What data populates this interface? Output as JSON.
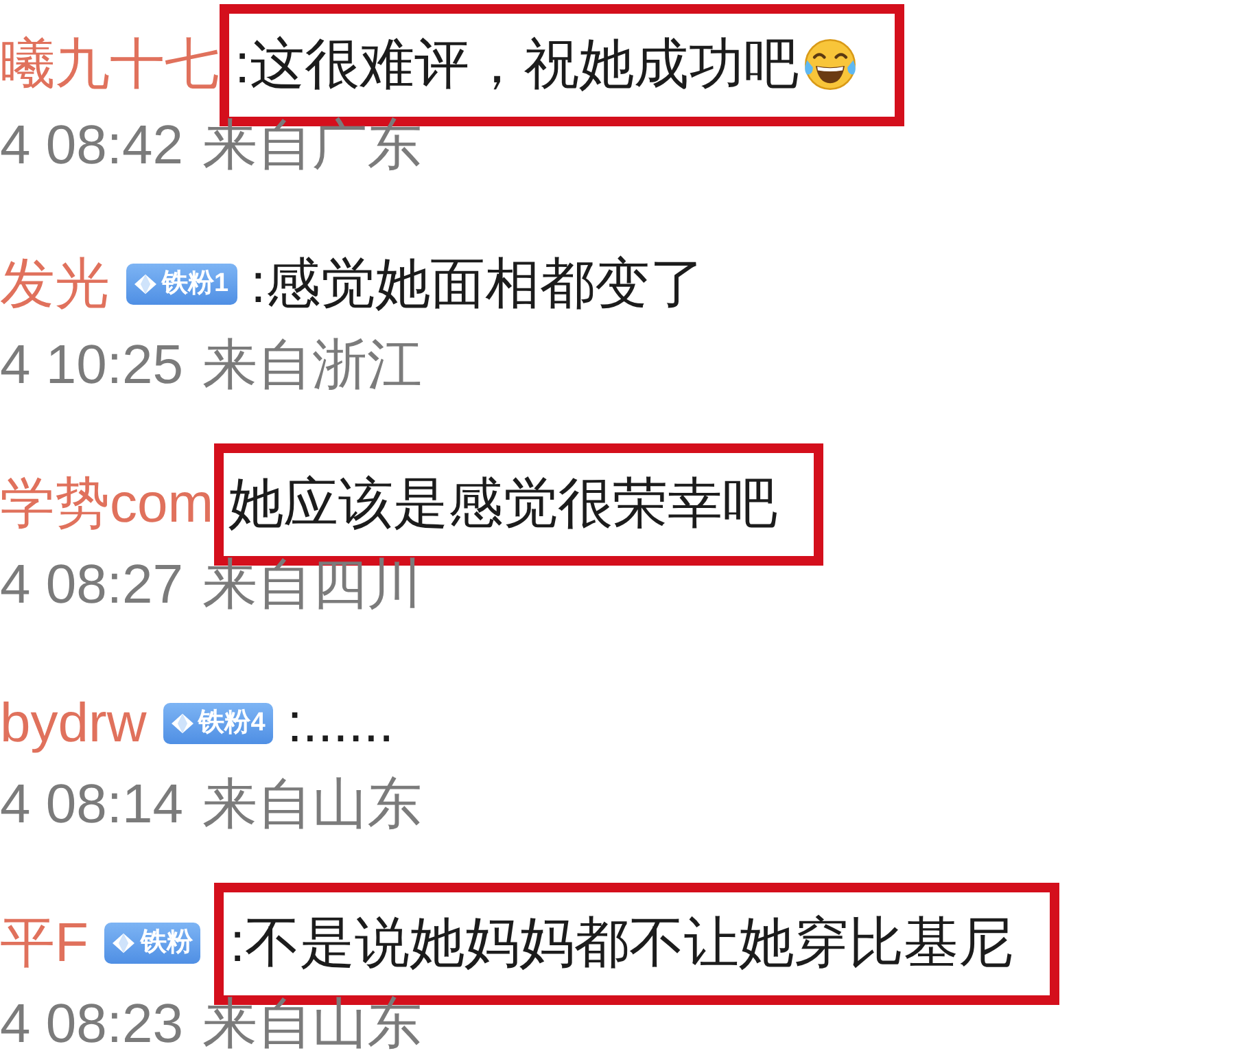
{
  "comments": [
    {
      "username": "曦九十七",
      "text": ":这很难评，祝她成功吧",
      "emoji": true,
      "highlighted": true,
      "time": "4 08:42",
      "location": "来自广东"
    },
    {
      "username": "发光",
      "badge": "铁粉1",
      "text": ":感觉她面相都变了",
      "highlighted": false,
      "time": "4 10:25",
      "location": "来自浙江"
    },
    {
      "username": "学势com",
      "text": "她应该是感觉很荣幸吧",
      "highlighted": true,
      "time": "4 08:27",
      "location": "来自四川"
    },
    {
      "username": "bydrw",
      "badge": "铁粉4",
      "text": ":......",
      "highlighted": false,
      "time": "4 08:14",
      "location": "来自山东"
    },
    {
      "username": "平F",
      "badge": "铁粉",
      "text": ":不是说她妈妈都不让她穿比基尼",
      "highlighted": true,
      "time": "4 08:23",
      "location": "来自山东"
    }
  ]
}
